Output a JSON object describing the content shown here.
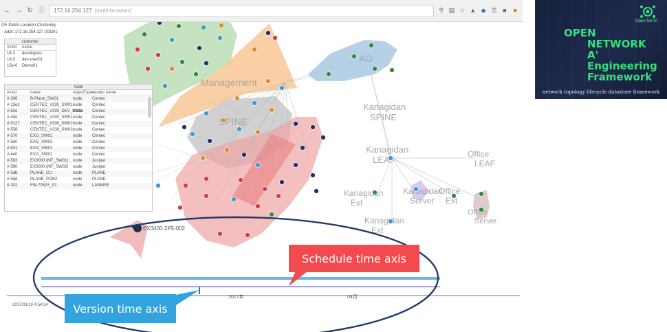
{
  "browser": {
    "url": "172.16.254.127",
    "url_extra": "(multi-browser)",
    "page_title": "OF-Patch Location Clustering",
    "page_subtitle": "Addr. 172.16.254.127 2018/1"
  },
  "customer_table": {
    "title": "customer",
    "columns": [
      "#vxid",
      "name"
    ],
    "rows": [
      [
        "16-3",
        "developers"
      ],
      [
        "16-3",
        "dev-user01"
      ],
      [
        "15e-0",
        "Demo01"
      ]
    ]
  },
  "node_table": {
    "title": "node",
    "columns": [
      "#vxid",
      "name",
      "objectType",
      "vendor",
      "name"
    ],
    "rows": [
      [
        "#-306",
        "B-Plane_SW01",
        "node",
        "Centec",
        ""
      ],
      [
        "#-13e2",
        "CENTEC_V330_SW01",
        "node",
        "Centec",
        ""
      ],
      [
        "#-50e",
        "CENTEC_V330_DEV_SW01",
        "node",
        "Centec",
        ""
      ],
      [
        "#-40e",
        "CENTEC_V330_SW01",
        "node",
        "Centec",
        ""
      ],
      [
        "#-5127",
        "CENTEC_V330_SW02",
        "node",
        "Centec",
        ""
      ],
      [
        "#-558",
        "CENTEC_V330_SW03",
        "node",
        "Centec",
        ""
      ],
      [
        "#-370",
        "EXG_SW01",
        "node",
        "Centec",
        ""
      ],
      [
        "#-3e0",
        "EXG_SW02",
        "node",
        "Centec",
        ""
      ],
      [
        "#-531",
        "EXG_SW01",
        "node",
        "Centec",
        ""
      ],
      [
        "#-4e0",
        "EXG_SW01",
        "node",
        "Centec",
        ""
      ],
      [
        "#-583",
        "EX0000 (MT_SW01)",
        "node",
        "Juniper",
        ""
      ],
      [
        "#-590",
        "EX0000 (MT_SW02)",
        "node",
        "Juniper",
        ""
      ],
      [
        "#-5db",
        "PLANE_CU",
        "node",
        "PLANE",
        ""
      ],
      [
        "#-5dd",
        "PLANE_PON2",
        "node",
        "PLANE",
        ""
      ],
      [
        "#-332",
        "FW-7052S_01",
        "node",
        "LANNER",
        ""
      ]
    ]
  },
  "clusters": [
    {
      "label": "Management",
      "color": "#f8c48e"
    },
    {
      "label": "AG",
      "color": "#a9c9e2"
    },
    {
      "label": "SPINE",
      "color": "#c9c9c9"
    },
    {
      "label": "Kanagidan SPINE",
      "color": ""
    },
    {
      "label": "Kanagidan LEAF",
      "color": ""
    },
    {
      "label": "Office LEAF",
      "color": ""
    },
    {
      "label": "Kanagidan Ext",
      "color": ""
    },
    {
      "label": "Office Ext",
      "color": ""
    },
    {
      "label": "Kanagidan Server",
      "color": ""
    },
    {
      "label": "Office Server",
      "color": ""
    },
    {
      "label": "Kanagidan Ext",
      "color": ""
    }
  ],
  "node_label": "EX3400-2F5-002",
  "timeline": {
    "timestamp": "2017/03/10 4:54:34",
    "tick_labels": [
      "2017年",
      "04月"
    ],
    "schedule_label": "Schedule time axis",
    "version_label": "Version time axis",
    "line_color": "#66b6f0",
    "ellipse_color": "#253a6b"
  },
  "branding": {
    "logo_text": "Open Na°El",
    "lines": [
      "OPEN",
      "NETWORK",
      "A'",
      "Engineering",
      "Framework"
    ],
    "tagline": "network topology lifecycle datastore framework",
    "accent_color": "#35e07b"
  }
}
